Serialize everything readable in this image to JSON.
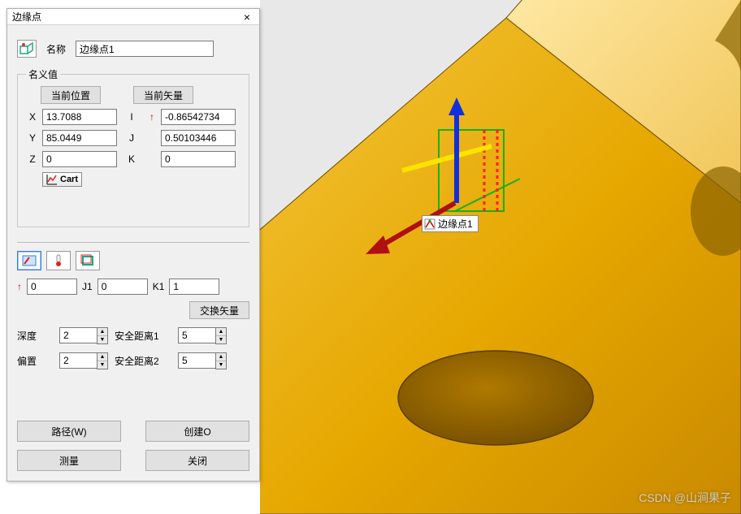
{
  "dialog": {
    "title": "边缘点",
    "name_label": "名称",
    "name_value": "边缘点1",
    "nominal_legend": "名义值",
    "btn_current_pos": "当前位置",
    "btn_current_vec": "当前矢量",
    "axes": {
      "x": "X",
      "y": "Y",
      "z": "Z",
      "i": "I",
      "j": "J",
      "k": "K"
    },
    "pos": {
      "x": "13.7088",
      "y": "85.0449",
      "z": "0"
    },
    "vec": {
      "i": "-0.86542734",
      "j": "0.50103446",
      "k": "0"
    },
    "cart_btn": "Cart",
    "dir_vec": {
      "i": "0",
      "j": "0",
      "k": "1"
    },
    "dir_labels": {
      "j": "J1",
      "k": "K1"
    },
    "swap_vec_btn": "交换矢量",
    "params": {
      "depth_lbl": "深度",
      "depth": "2",
      "safe1_lbl": "安全距离1",
      "safe1": "5",
      "offset_lbl": "偏置",
      "offset": "2",
      "safe2_lbl": "安全距离2",
      "safe2": "5"
    },
    "bottom": {
      "path": "路径(W)",
      "create": "创建O",
      "measure": "测量",
      "close": "关闭"
    }
  },
  "scene": {
    "point_label": "边缘点1"
  },
  "watermark": "CSDN @山涧果子"
}
